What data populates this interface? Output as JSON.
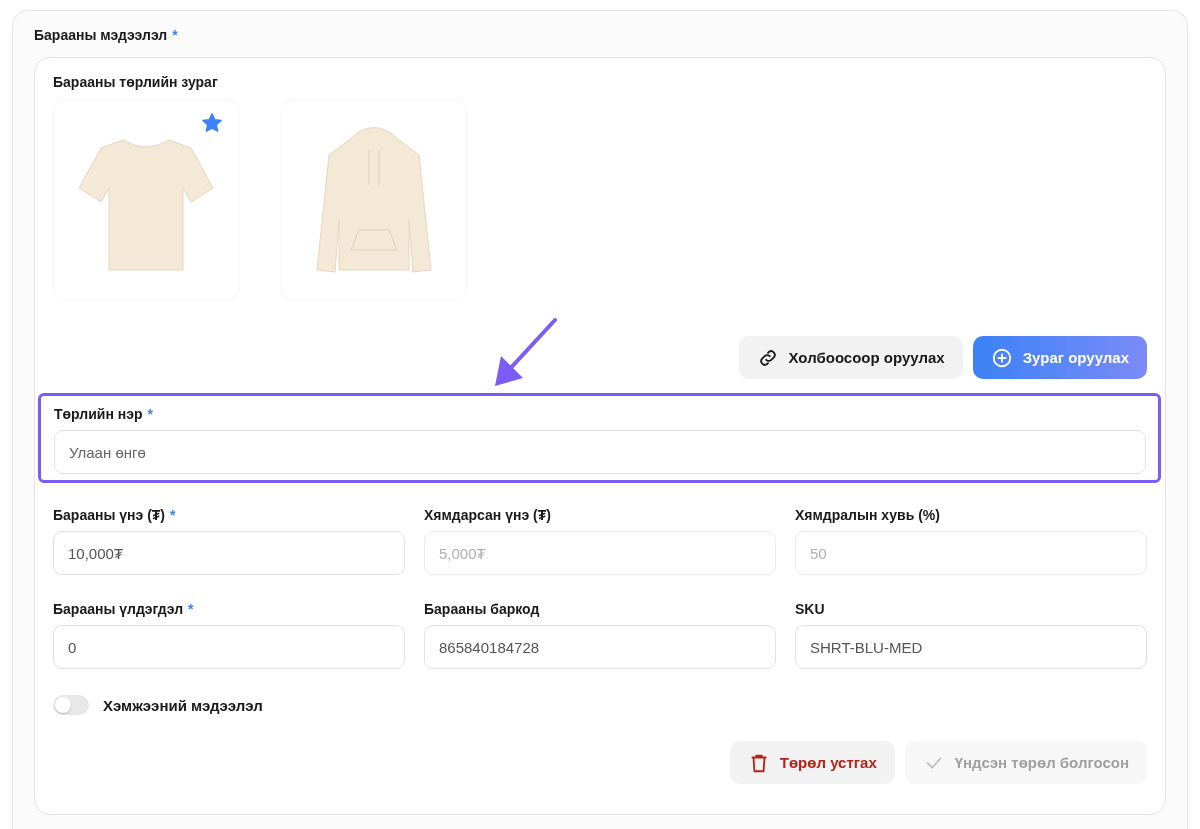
{
  "section": {
    "title": "Барааны мэдээлэл",
    "required_mark": "*"
  },
  "images_section": {
    "title": "Барааны төрлийн зураг",
    "images": [
      {
        "kind": "tshirt",
        "primary": true
      },
      {
        "kind": "hoodie",
        "primary": false
      }
    ],
    "buttons": [
      {
        "kind": "link",
        "label": "Холбоосоор оруулах"
      },
      {
        "kind": "upload",
        "label": "Зураг оруулах"
      }
    ]
  },
  "variant_name": {
    "label": "Төрлийн нэр",
    "required_mark": "*",
    "placeholder": "Улаан өнгө",
    "highlighted": true
  },
  "fields": [
    {
      "label": "Барааны үнэ (₮)",
      "required_mark": "*",
      "value": "10,000₮",
      "disabled": false
    },
    {
      "label": "Хямдарсан үнэ (₮)",
      "value": "5,000₮",
      "disabled": true
    },
    {
      "label": "Хямдралын хувь (%)",
      "value": "50",
      "disabled": true
    },
    {
      "label": "Барааны үлдэгдэл",
      "required_mark": "*",
      "value": "0",
      "disabled": false
    },
    {
      "label": "Барааны баркод",
      "value": "865840184728",
      "disabled": false
    },
    {
      "label": "SKU",
      "value": "SHRT-BLU-MED",
      "disabled": false
    }
  ],
  "toggle": {
    "label": "Хэмжээний мэдээлэл",
    "on": false
  },
  "actions": [
    {
      "kind": "delete",
      "label": "Төрөл устгах",
      "disabled": false
    },
    {
      "kind": "set_default",
      "label": "Үндсэн төрөл болгосон",
      "disabled": true
    }
  ]
}
